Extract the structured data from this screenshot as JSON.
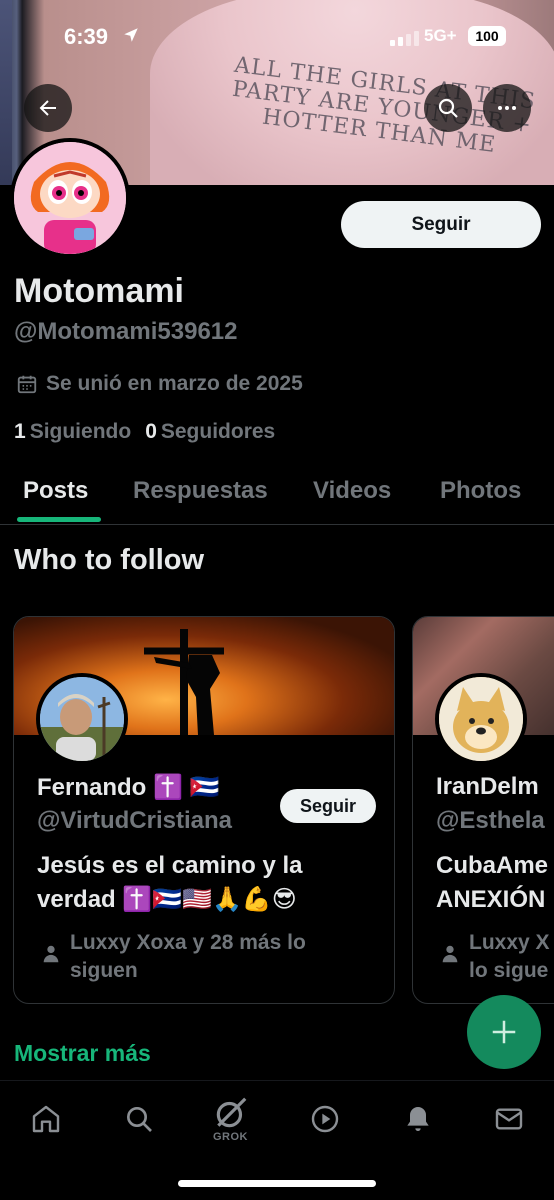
{
  "status_bar": {
    "time": "6:39",
    "network": "5G+",
    "battery": "100"
  },
  "banner": {
    "shirt_text": "ALL THE GIRLS AT THIS PARTY ARE YOUNGER + HOTTER THAN ME"
  },
  "profile": {
    "follow_label": "Seguir",
    "name": "Motomami",
    "handle": "@Motomami539612",
    "joined": "Se unió en marzo de 2025",
    "following_count": "1",
    "following_label": "Siguiendo",
    "followers_count": "0",
    "followers_label": "Seguidores"
  },
  "tabs": [
    "Posts",
    "Respuestas",
    "Videos",
    "Photos"
  ],
  "who_to_follow": {
    "title": "Who to follow",
    "cards": [
      {
        "name": "Fernando ✝️ 🇨🇺",
        "handle": "@VirtudCristiana",
        "follow_label": "Seguir",
        "bio": "Jesús es el camino y la verdad ✝️🇨🇺🇺🇸🙏💪😎",
        "followed_by": "Luxxy Xoxa y 28 más lo siguen"
      },
      {
        "name": "IranDelm",
        "handle": "@Esthela",
        "bio": "CubaAme ANEXIÓN",
        "followed_by": "Luxxy X lo sigue"
      }
    ],
    "show_more": "Mostrar más"
  },
  "bottom_nav": {
    "grok_label": "GROK"
  },
  "colors": {
    "accent": "#17b67a",
    "fab": "#148a5d",
    "muted": "#71767b"
  }
}
